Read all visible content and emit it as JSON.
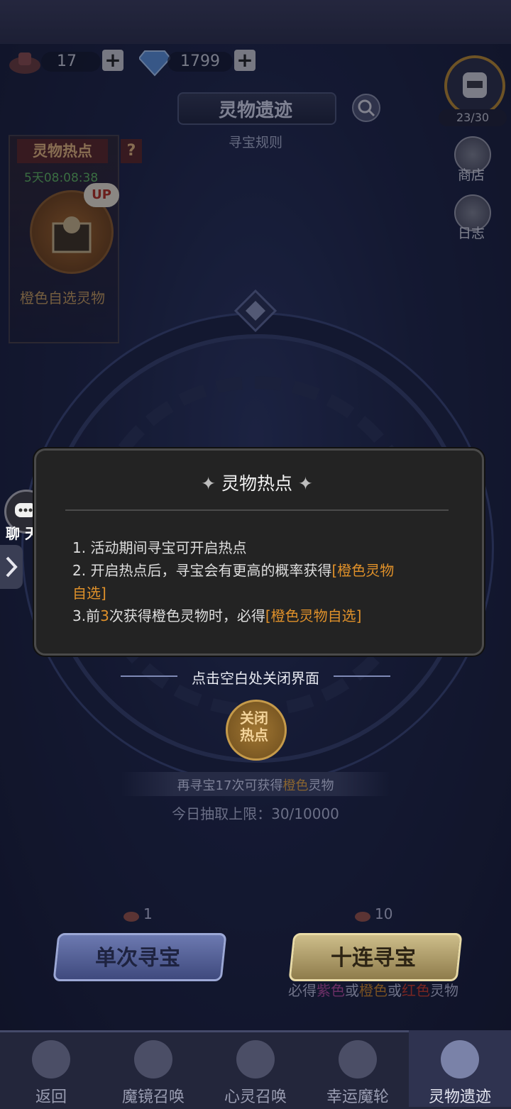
{
  "currency": {
    "ticket_count": "17",
    "ticket_icon": "ticket-icon",
    "diamond_count": "1799",
    "diamond_icon": "diamond-icon",
    "plus": "+"
  },
  "stamina": {
    "value": "23/30"
  },
  "header": {
    "title": "灵物遗迹",
    "rules": "寻宝规则"
  },
  "side_menu": {
    "shop": "商店",
    "log": "日志"
  },
  "hotspot": {
    "title": "灵物热点",
    "help": "?",
    "timer": "5天08:08:38",
    "badge": "UP",
    "reward": "橙色自选灵物"
  },
  "chat": {
    "label": "聊 天"
  },
  "dialog": {
    "title": "灵物热点",
    "line1": "1. 活动期间寻宝可开启热点",
    "line2_a": "2. 开启热点后，寻宝会有更高的概率获得",
    "line2_b": "[橙色灵物",
    "line2_c": "自选]",
    "line3_a": "3.前",
    "line3_b": "3",
    "line3_c": "次获得橙色灵物时，必得",
    "line3_d": "[橙色灵物自选]"
  },
  "close_hint": "点击空白处关闭界面",
  "close_hotspot": "关闭\n热点",
  "progress": {
    "remaining_a": "再寻宝17次可获得",
    "remaining_b": "橙色",
    "remaining_c": "灵物",
    "daily_limit": "今日抽取上限：30/10000"
  },
  "draw": {
    "single_cost": "1",
    "single_label": "单次寻宝",
    "ten_cost": "10",
    "ten_label": "十连寻宝",
    "guarantee_a": "必得",
    "guarantee_b": "紫色",
    "guarantee_c": "或",
    "guarantee_d": "橙色",
    "guarantee_e": "或",
    "guarantee_f": "红色",
    "guarantee_g": "灵物"
  },
  "colors": {
    "orange": "#e0912a",
    "purple": "#c64fb8",
    "red": "#d9362f"
  },
  "nav": [
    {
      "label": "返回",
      "icon": "back-icon"
    },
    {
      "label": "魔镜召唤",
      "icon": "mirror-icon"
    },
    {
      "label": "心灵召唤",
      "icon": "crystal-icon"
    },
    {
      "label": "幸运魔轮",
      "icon": "wheel-icon"
    },
    {
      "label": "灵物遗迹",
      "icon": "relic-icon"
    }
  ]
}
